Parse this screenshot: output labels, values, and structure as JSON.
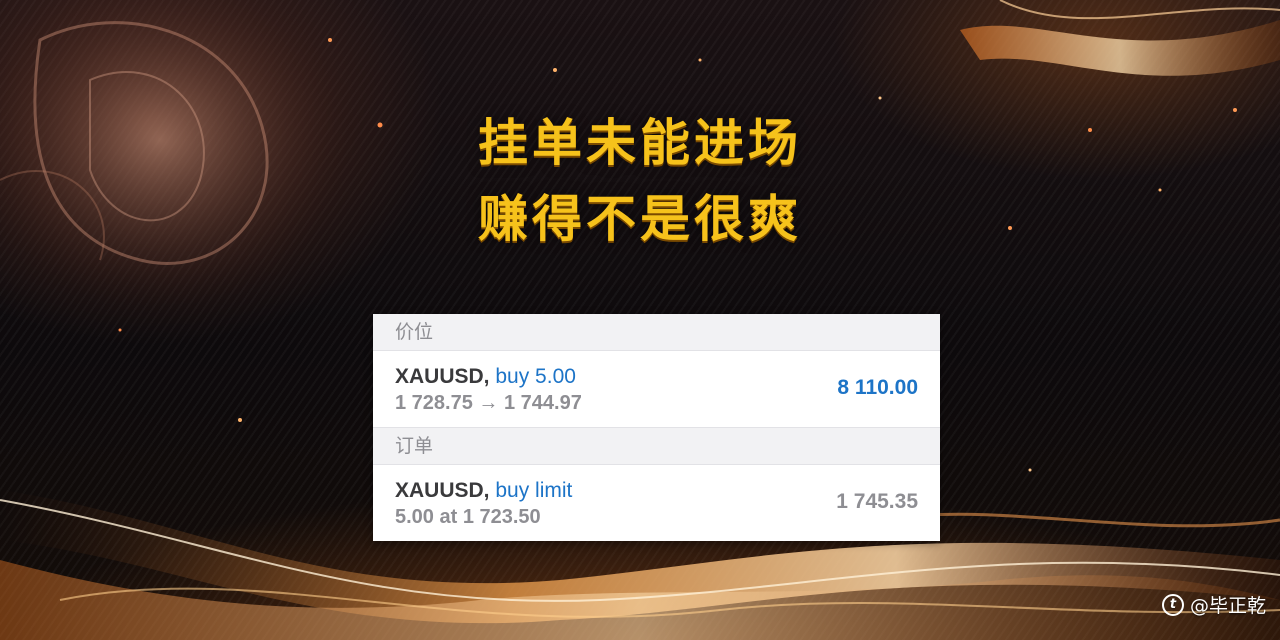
{
  "headline": {
    "line1": "挂单未能进场",
    "line2": "赚得不是很爽"
  },
  "positions_section": {
    "header": "价位",
    "rows": [
      {
        "symbol": "XAUUSD,",
        "action": "buy 5.00",
        "detail": "1 728.75 → 1 744.97",
        "value": "8 110.00"
      }
    ]
  },
  "orders_section": {
    "header": "订单",
    "rows": [
      {
        "symbol": "XAUUSD,",
        "action": "buy limit",
        "detail": "5.00 at 1 723.50",
        "value": "1 745.35"
      }
    ]
  },
  "watermark": {
    "icon": "toutiao-logo-icon",
    "text": "@毕正乾"
  },
  "colors": {
    "headline": "#f6c21b",
    "accent_blue": "#1d74c7",
    "muted_gray": "#8e8e93"
  }
}
